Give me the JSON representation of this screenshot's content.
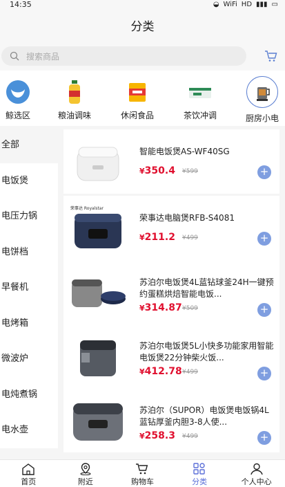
{
  "status": {
    "time": "14:35",
    "icons": [
      "◒",
      "WiFi",
      "HD",
      "▮▮▮",
      "▭"
    ]
  },
  "header": {
    "title": "分类"
  },
  "search": {
    "placeholder": "搜索商品"
  },
  "categories": [
    {
      "label": "鲸选区",
      "icon": "whale-icon"
    },
    {
      "label": "粮油调味",
      "icon": "oil-bottle-icon"
    },
    {
      "label": "休闲食品",
      "icon": "snack-bag-icon"
    },
    {
      "label": "茶饮冲调",
      "icon": "tea-box-icon"
    },
    {
      "label": "厨房小电",
      "icon": "kettle-icon"
    }
  ],
  "sidebar": {
    "items": [
      "全部",
      "电饭煲",
      "电压力锅",
      "电饼档",
      "早餐机",
      "电烤箱",
      "微波炉",
      "电炖煮锅",
      "电水壶"
    ]
  },
  "products": [
    {
      "name": "智能电饭煲AS-WF40SG",
      "price": "350.4",
      "old": "599",
      "brand": ""
    },
    {
      "name": "荣事达电脑煲RFB-S4081",
      "price": "211.2",
      "old": "499",
      "brand": "荣事达 Royalstar"
    },
    {
      "name": "苏泊尔电饭煲4L蓝钻球釜24H一键预约蛋糕烘焙智能电饭...",
      "price": "314.87",
      "old": "509",
      "brand": ""
    },
    {
      "name": "苏泊尔电饭煲5L小快多功能家用智能电饭煲22分钟柴火饭...",
      "price": "412.78",
      "old": "499",
      "brand": ""
    },
    {
      "name": "苏泊尔（SUPOR）电饭煲电饭锅4L蓝钻厚釜内胆3-8人使...",
      "price": "258.3",
      "old": "499",
      "brand": ""
    }
  ],
  "currency": "¥",
  "tabbar": [
    {
      "label": "首页",
      "icon": "home-icon"
    },
    {
      "label": "附近",
      "icon": "location-icon"
    },
    {
      "label": "购物车",
      "icon": "cart-icon"
    },
    {
      "label": "分类",
      "icon": "category-icon"
    },
    {
      "label": "个人中心",
      "icon": "user-icon"
    }
  ],
  "colors": {
    "accent": "#5b6fd8",
    "price": "#e0102f",
    "add_button": "#7f9ee0"
  }
}
